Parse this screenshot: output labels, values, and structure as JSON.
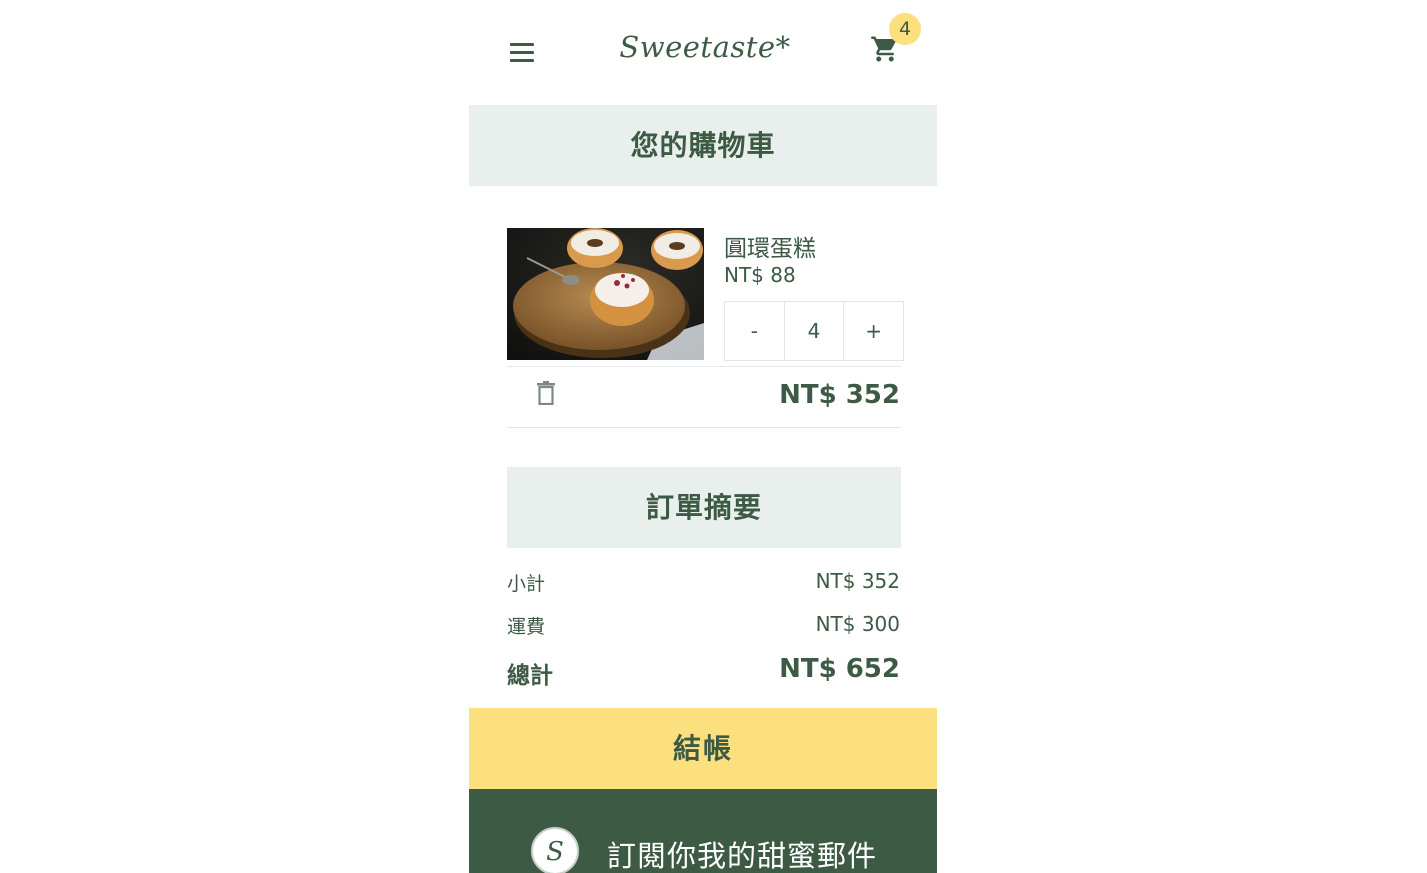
{
  "header": {
    "logo": "Sweetaste*",
    "cart_count": "4"
  },
  "cart": {
    "title": "您的購物車",
    "items": [
      {
        "name": "圓環蛋糕",
        "price": "NT$ 88",
        "minus_label": "-",
        "quantity": "4",
        "plus_label": "+",
        "line_total": "NT$ 352"
      }
    ]
  },
  "summary": {
    "title": "訂單摘要",
    "subtotal_label": "小計",
    "subtotal_value": "NT$ 352",
    "shipping_label": "運費",
    "shipping_value": "NT$ 300",
    "total_label": "總計",
    "total_value": "NT$ 652"
  },
  "checkout": {
    "label": "結帳"
  },
  "footer": {
    "logo_letter": "S",
    "subscribe_text": "訂閱你我的甜蜜郵件"
  },
  "colors": {
    "brand_green": "#3d5a45",
    "accent_yellow": "#fde07e",
    "section_bg": "#e9efec"
  },
  "icons": [
    "menu-icon",
    "cart-icon",
    "trash-icon"
  ]
}
